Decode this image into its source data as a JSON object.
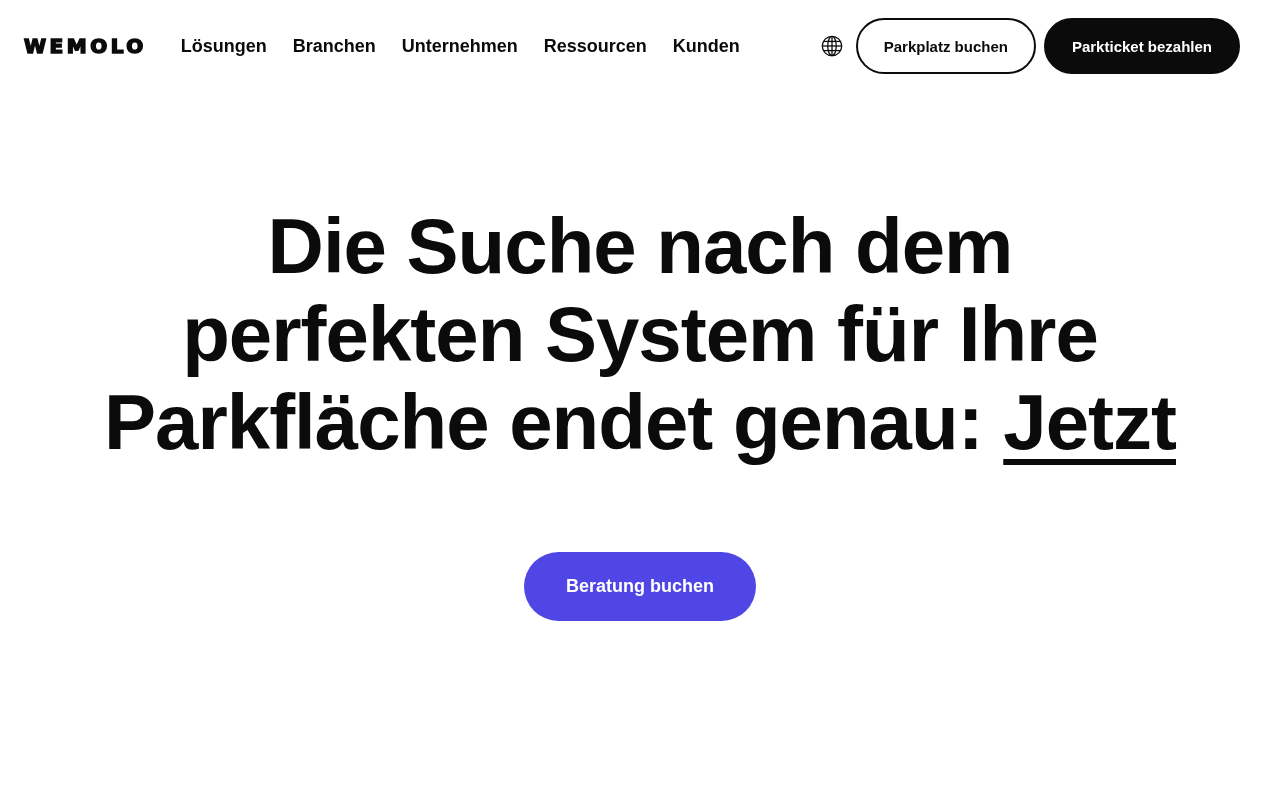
{
  "header": {
    "logo": "WEMOLO",
    "nav": [
      "Lösungen",
      "Branchen",
      "Unternehmen",
      "Ressourcen",
      "Kunden"
    ],
    "buttons": [
      {
        "label": "Parkplatz buchen",
        "kind": "outline"
      },
      {
        "label": "Parkticket bezahlen",
        "kind": "filled"
      }
    ]
  },
  "hero": {
    "headline": "Die Suche nach dem perfekten System für Ihre Parkfläche endet genau:",
    "headline_link": "Jetzt",
    "cta": "Beratung buchen"
  }
}
